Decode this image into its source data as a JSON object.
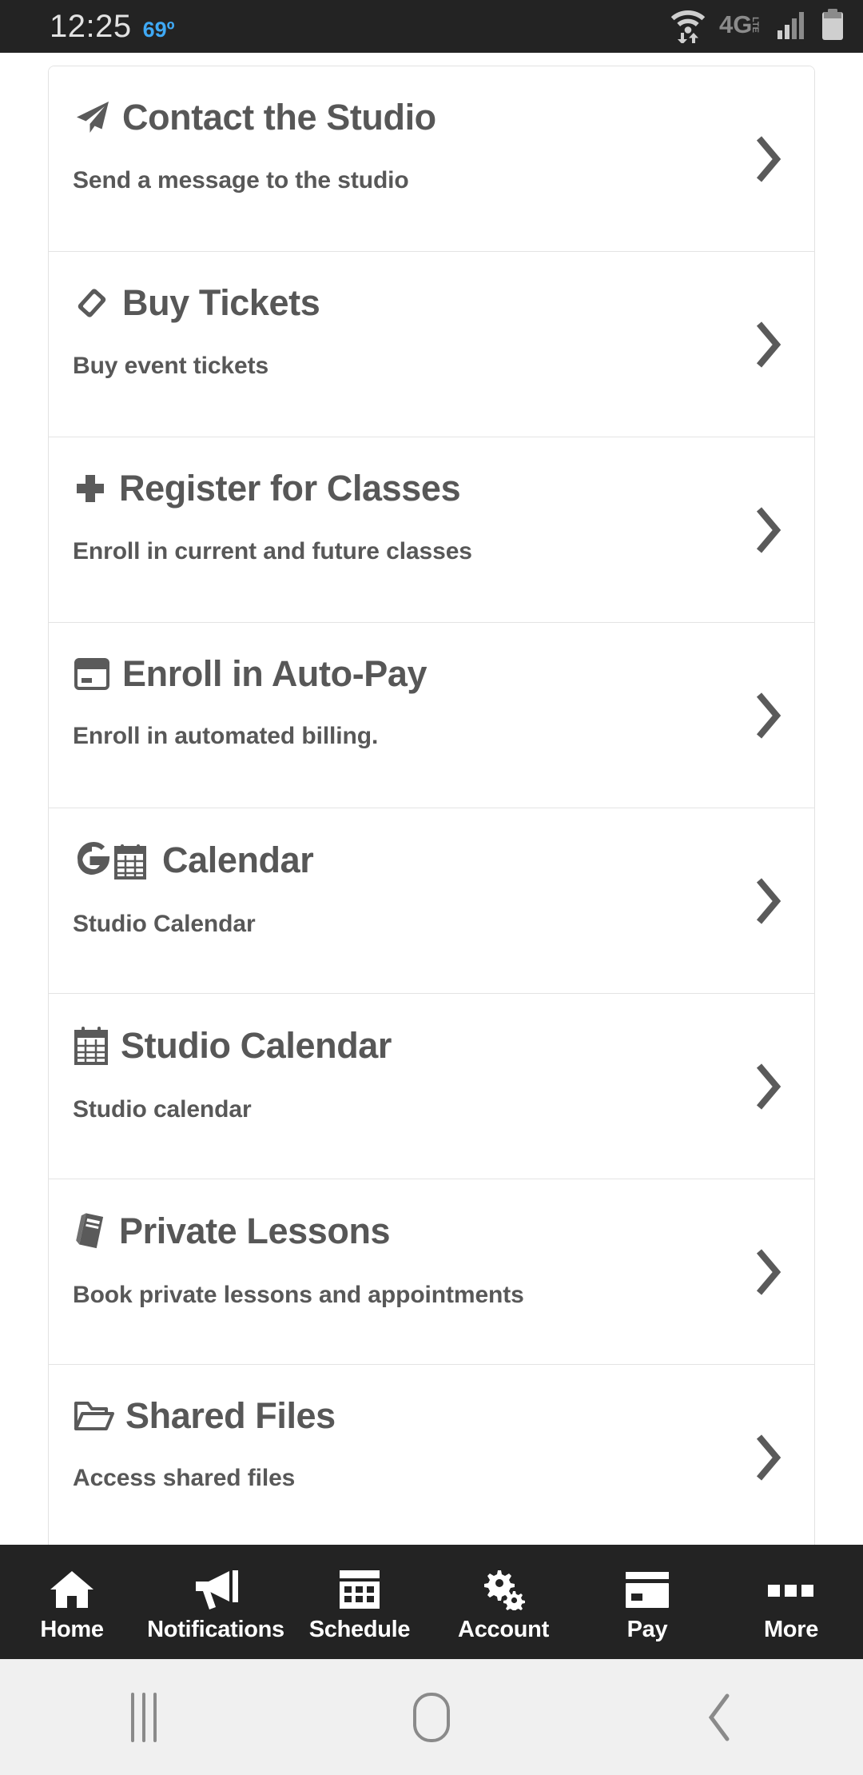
{
  "status_bar": {
    "time": "12:25",
    "temperature": "69º",
    "icons": [
      "wifi-data-icon",
      "4g-lte-icon",
      "signal-bars-icon",
      "battery-icon"
    ]
  },
  "menu": {
    "items": [
      {
        "icon": "paper-plane-icon",
        "title": "Contact the Studio",
        "subtitle": "Send a message to the studio",
        "chevron": "chevron-right-icon"
      },
      {
        "icon": "ticket-icon",
        "title": "Buy Tickets",
        "subtitle": "Buy event tickets",
        "chevron": "chevron-right-icon"
      },
      {
        "icon": "plus-icon",
        "title": "Register for Classes",
        "subtitle": "Enroll in current and future classes",
        "chevron": "chevron-right-icon"
      },
      {
        "icon": "credit-card-icon",
        "title": "Enroll in Auto-Pay",
        "subtitle": "Enroll in automated billing.",
        "chevron": "chevron-right-icon"
      },
      {
        "icon": "google-calendar-icon",
        "title": "Calendar",
        "subtitle": "Studio Calendar",
        "chevron": "chevron-right-icon"
      },
      {
        "icon": "calendar-icon",
        "title": "Studio Calendar",
        "subtitle": "Studio calendar",
        "chevron": "chevron-right-icon"
      },
      {
        "icon": "book-icon",
        "title": "Private Lessons",
        "subtitle": "Book private lessons and appointments",
        "chevron": "chevron-right-icon"
      },
      {
        "icon": "folder-open-icon",
        "title": "Shared Files",
        "subtitle": "Access shared files",
        "chevron": "chevron-right-icon"
      }
    ]
  },
  "tab_bar": {
    "items": [
      {
        "icon": "home-icon",
        "label": "Home"
      },
      {
        "icon": "bullhorn-icon",
        "label": "Notifications"
      },
      {
        "icon": "calendar-grid-icon",
        "label": "Schedule"
      },
      {
        "icon": "gears-icon",
        "label": "Account"
      },
      {
        "icon": "credit-card-icon",
        "label": "Pay"
      },
      {
        "icon": "ellipsis-icon",
        "label": "More"
      }
    ]
  },
  "nav_bar": {
    "recents": "recents-icon",
    "home": "home-pill-icon",
    "back": "back-chevron-icon"
  },
  "colors": {
    "status_bar_bg": "#232323",
    "tab_bar_bg": "#232323",
    "nav_bar_bg": "#f0f0f0",
    "card_bg": "#ffffff",
    "text_gray": "#575757",
    "temp_blue": "#3fa9f5",
    "divider": "#e4e4e4"
  }
}
